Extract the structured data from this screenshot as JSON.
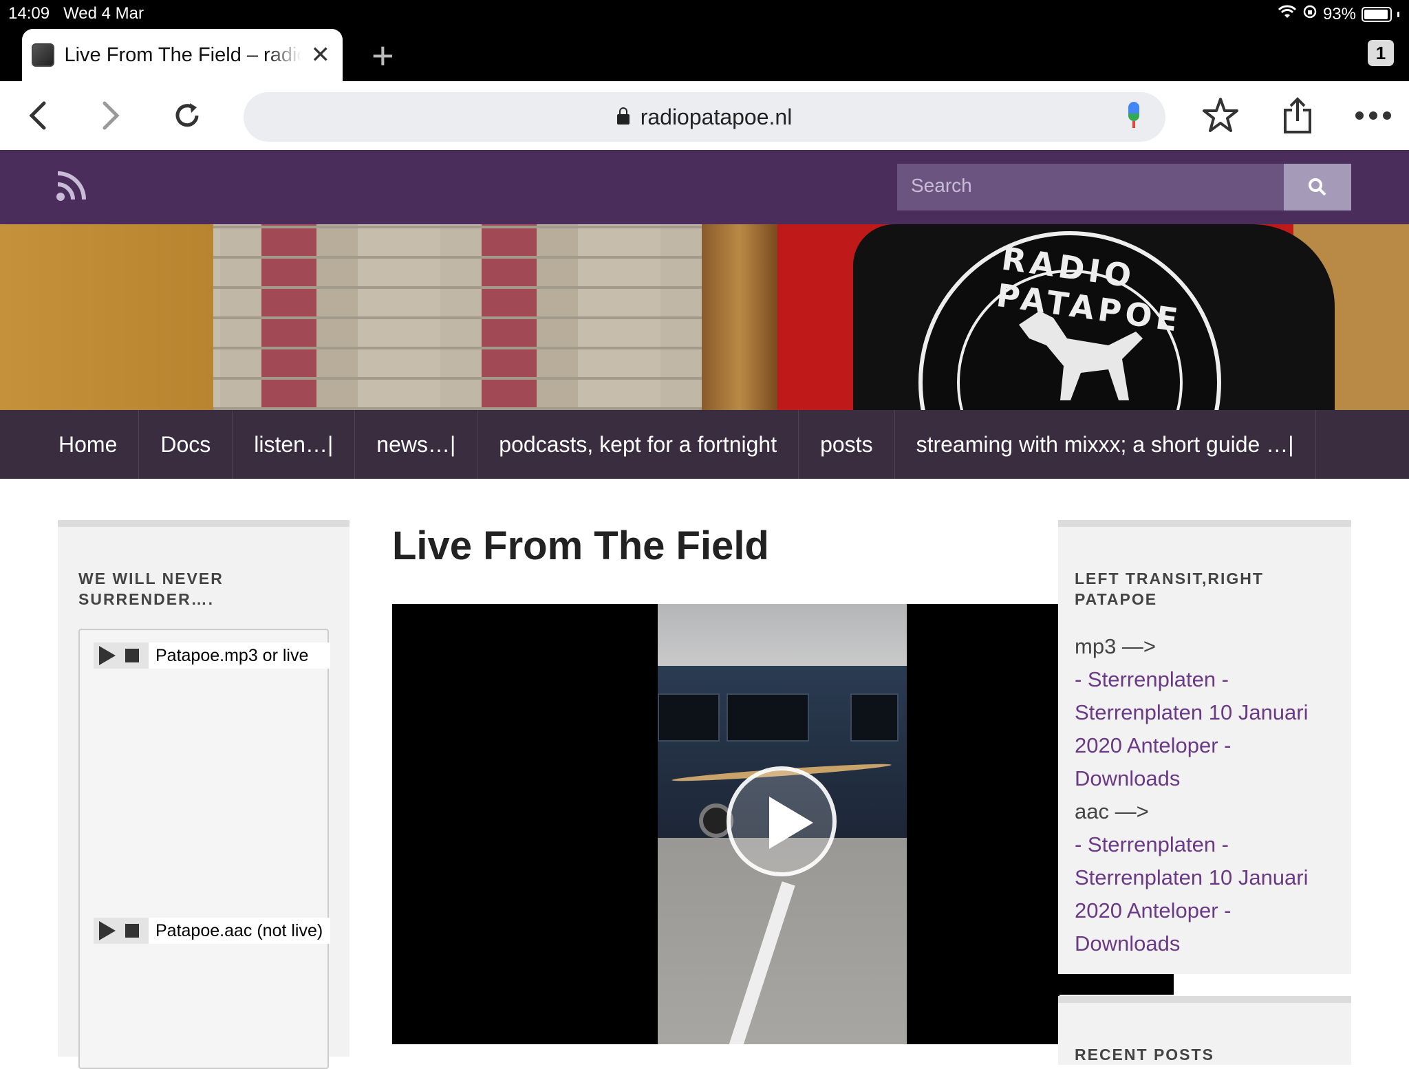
{
  "status_bar": {
    "time": "14:09",
    "date": "Wed 4 Mar",
    "battery": "93%"
  },
  "browser": {
    "tab_title": "Live From The Field – radio patapoe",
    "tab_count": "1",
    "url": "radiopatapoe.nl"
  },
  "site": {
    "search_placeholder": "Search",
    "nav": [
      "Home",
      "Docs",
      "listen…|",
      "news…|",
      "podcasts, kept for a fortnight",
      "posts",
      "streaming with mixxx; a short guide …|"
    ],
    "banner_seal_text": "RADIO PATAPOE",
    "colors": {
      "header": "#4b2d5c",
      "nav": "#3a2d40",
      "link": "#6b3a86"
    }
  },
  "left_sidebar": {
    "widget_title": "WE WILL NEVER SURRENDER….",
    "players": [
      {
        "label": "Patapoe.mp3 or live"
      },
      {
        "label": "Patapoe.aac (not live)"
      }
    ]
  },
  "main": {
    "title": "Live From The Field"
  },
  "right_sidebar": {
    "widget_title": "LEFT TRANSIT,RIGHT PATAPOE",
    "mp3_heading": "mp3 —>",
    "mp3_links": [
      "- Sterrenplaten -",
      "Sterrenplaten 10 Januari",
      "2020 Anteloper -",
      "Downloads"
    ],
    "aac_heading": "aac —>",
    "aac_links": [
      "- Sterrenplaten -",
      "Sterrenplaten 10 Januari",
      "2020 Anteloper -",
      "Downloads"
    ],
    "recent_posts_title": "RECENT POSTS"
  }
}
